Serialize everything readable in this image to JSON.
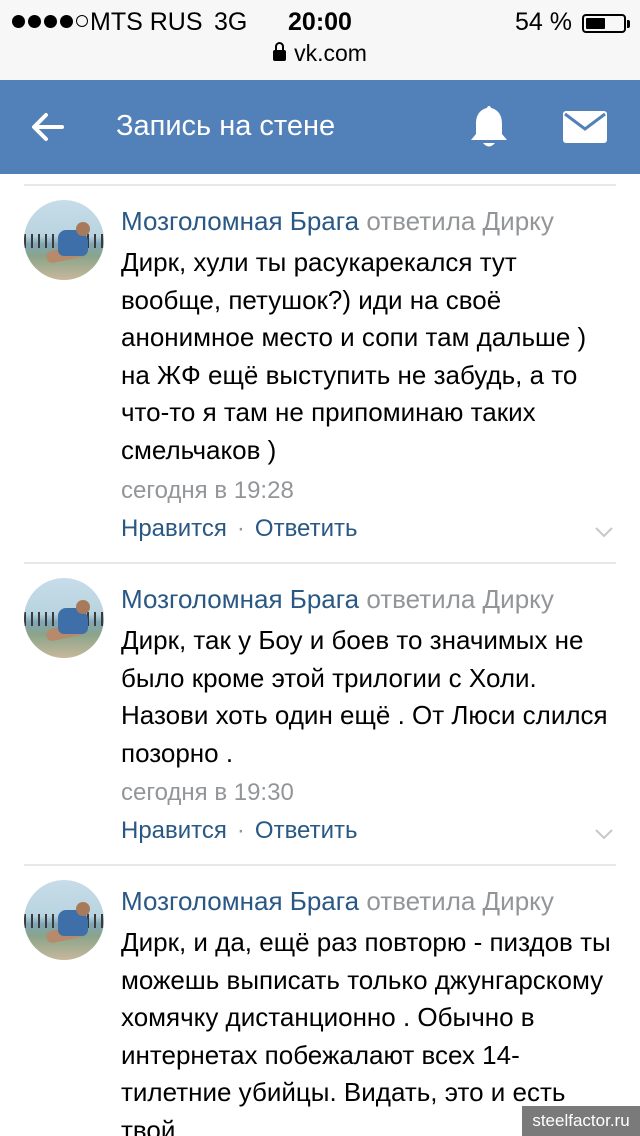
{
  "status": {
    "carrier": "MTS RUS",
    "network": "3G",
    "time": "20:00",
    "battery": "54 %",
    "battery_level": 0.54,
    "url": "vk.com"
  },
  "header": {
    "title": "Запись на стене",
    "color": "#5181b8"
  },
  "comments": [
    {
      "author": "Мозголомная Брага",
      "replied": "ответила Дирку",
      "text": "Дирк, хули ты расукарекался тут вообще, петушок?) иди на своё анонимное место и сопи там дальше ) на ЖФ ещё выступить не забудь, а то что-то я там не припоминаю таких смельчаков )",
      "date": "сегодня в 19:28",
      "like": "Нравится",
      "reply": "Ответить"
    },
    {
      "author": "Мозголомная Брага",
      "replied": "ответила Дирку",
      "text": "Дирк, так у Боу и боев то значимых не было кроме этой трилогии с Холи. Назови хоть один ещё . От Люси слился позорно .",
      "date": "сегодня в 19:30",
      "like": "Нравится",
      "reply": "Ответить"
    },
    {
      "author": "Мозголомная Брага",
      "replied": "ответила Дирку",
      "text": "Дирк, и да, ещё раз повторю - пиздов ты можешь выписать только джунгарскому хомячку дистанционно . Обычно в интернетах побежалают всех 14-тилетние убийцы. Видать, это и есть твой",
      "date": "",
      "like": "",
      "reply": ""
    }
  ],
  "watermark": "steelfactor.ru"
}
